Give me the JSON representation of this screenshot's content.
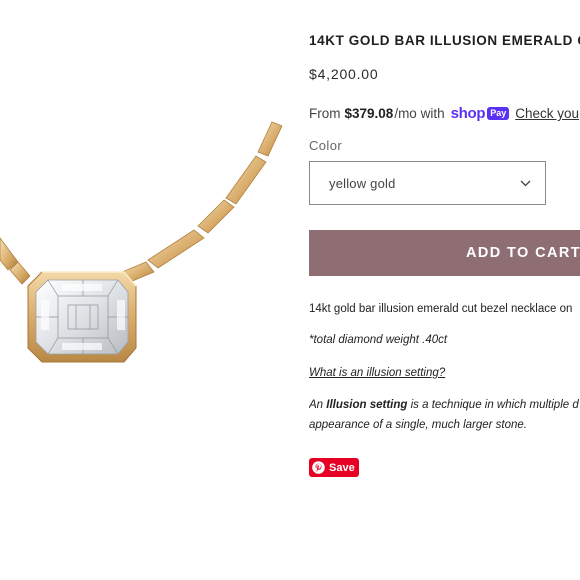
{
  "product": {
    "title": "14KT GOLD BAR ILLUSION EMERALD C",
    "price": "$4,200.00"
  },
  "installments": {
    "prefix": "From",
    "amount": "$379.08",
    "suffix": "/mo with",
    "provider_word": "shop",
    "provider_badge": "Pay",
    "link_text": "Check you"
  },
  "variant": {
    "label": "Color",
    "selected": "yellow gold"
  },
  "cart": {
    "button_label": "ADD TO CART"
  },
  "description": {
    "line1": "14kt gold bar illusion emerald cut bezel necklace on",
    "line2": "*total diamond weight .40ct",
    "link": "What is an illusion setting?",
    "line4_prefix": "An",
    "line4_bold": "Illusion setting",
    "line4_suffix": "is a technique in which multiple d",
    "line5": "appearance of a single, much larger stone."
  },
  "share": {
    "pinterest_label": "Save"
  },
  "colors": {
    "cart_button": "#8f6e73",
    "shop_pay": "#5a31f4",
    "pinterest": "#e60023",
    "gold": "#d8ae72"
  },
  "icons": [
    "chevron-down-icon",
    "pinterest-icon",
    "shop-pay-logo"
  ]
}
